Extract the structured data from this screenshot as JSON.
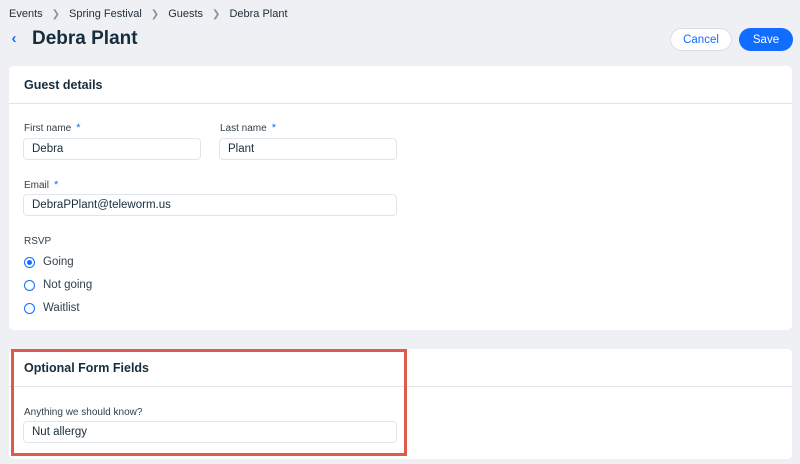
{
  "breadcrumb": [
    "Events",
    "Spring Festival",
    "Guests",
    "Debra Plant"
  ],
  "header": {
    "title": "Debra Plant",
    "cancel_label": "Cancel",
    "save_label": "Save"
  },
  "guest_details": {
    "heading": "Guest details",
    "first_name": {
      "label": "First name",
      "value": "Debra",
      "required_mark": "*"
    },
    "last_name": {
      "label": "Last name",
      "value": "Plant",
      "required_mark": "*"
    },
    "email": {
      "label": "Email",
      "value": "DebraPPlant@teleworm.us",
      "required_mark": "*"
    },
    "rsvp": {
      "label": "RSVP",
      "options": [
        "Going",
        "Not going",
        "Waitlist"
      ],
      "selected": "Going"
    }
  },
  "optional": {
    "heading": "Optional Form Fields",
    "question_label": "Anything we should know?",
    "answer": "Nut allergy"
  },
  "colors": {
    "accent": "#116dff",
    "highlight": "#e05a4c",
    "background": "#eef0f4"
  }
}
